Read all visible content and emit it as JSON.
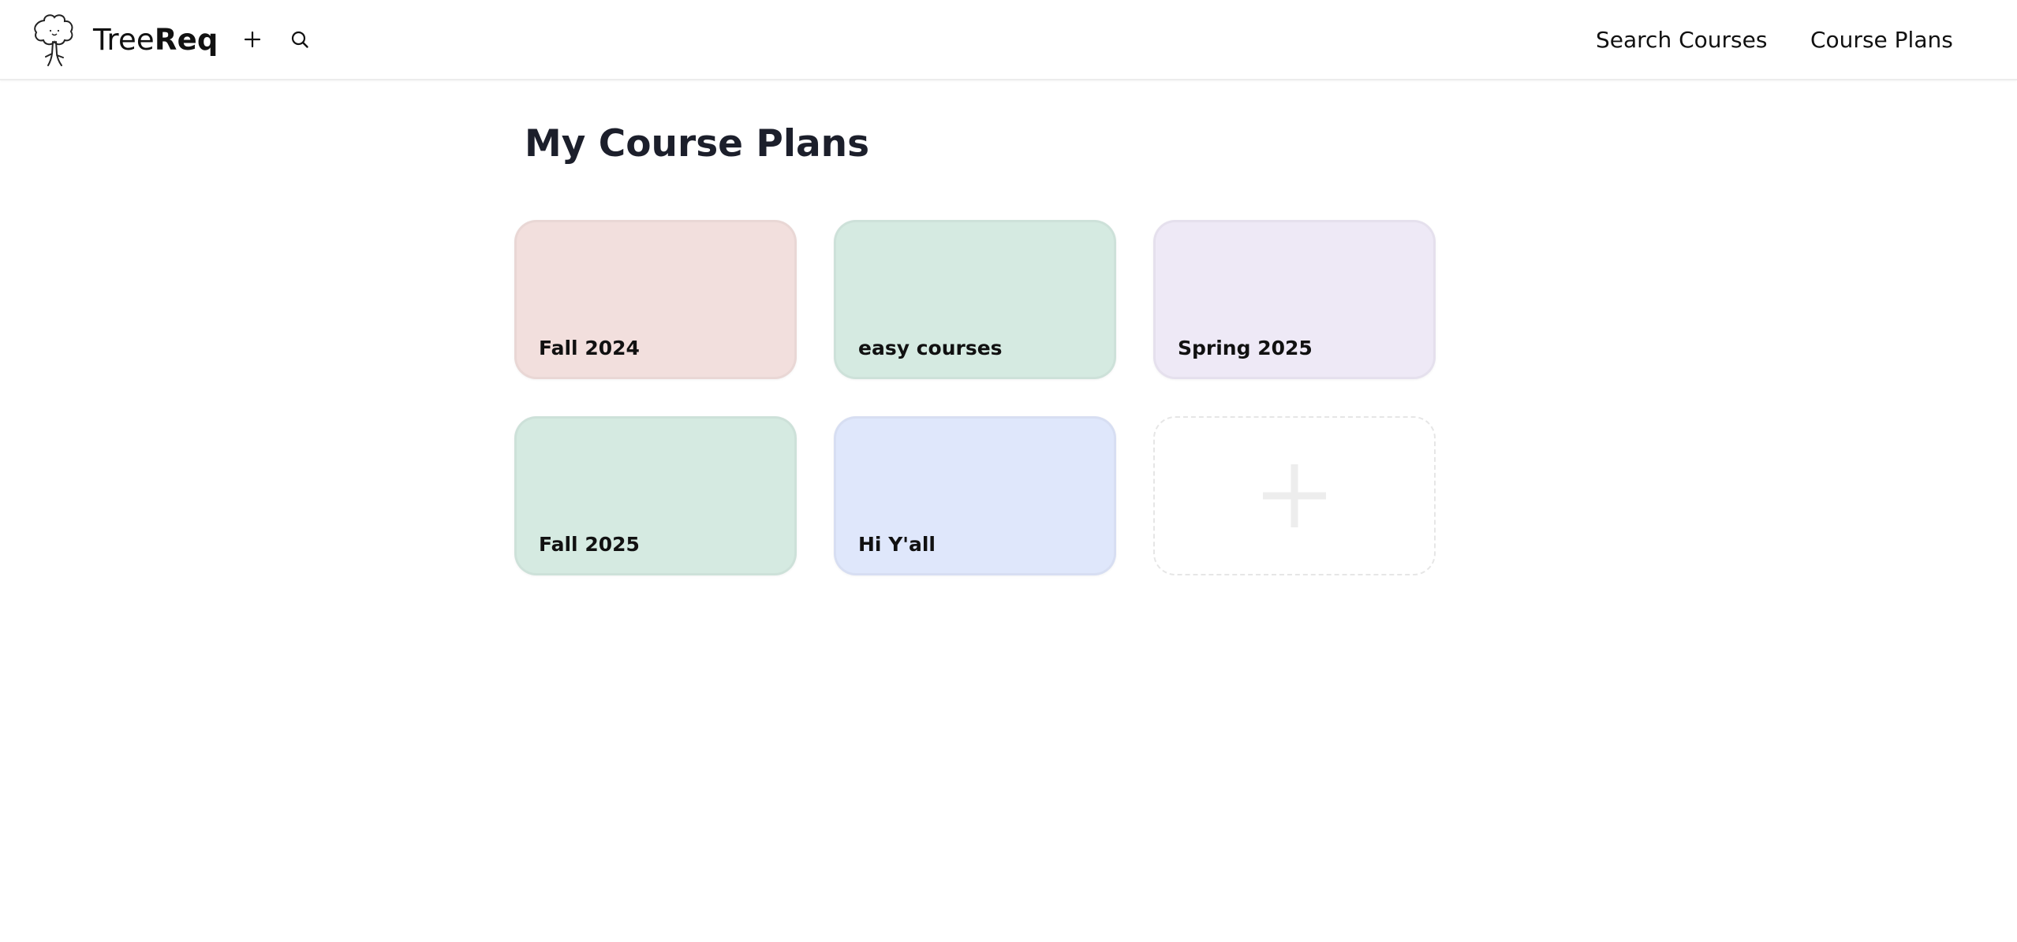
{
  "header": {
    "brand_prefix": "Tree",
    "brand_suffix": "Req",
    "nav": [
      {
        "label": "Search Courses"
      },
      {
        "label": "Course Plans"
      }
    ]
  },
  "main": {
    "title": "My Course Plans",
    "plans": [
      {
        "label": "Fall 2024",
        "color": "#f2dfdd"
      },
      {
        "label": "easy courses",
        "color": "#d5eae1"
      },
      {
        "label": "Spring 2025",
        "color": "#eee9f6"
      },
      {
        "label": "Fall 2025",
        "color": "#d5eae1"
      },
      {
        "label": "Hi Y'all",
        "color": "#dfe7fb"
      }
    ]
  }
}
